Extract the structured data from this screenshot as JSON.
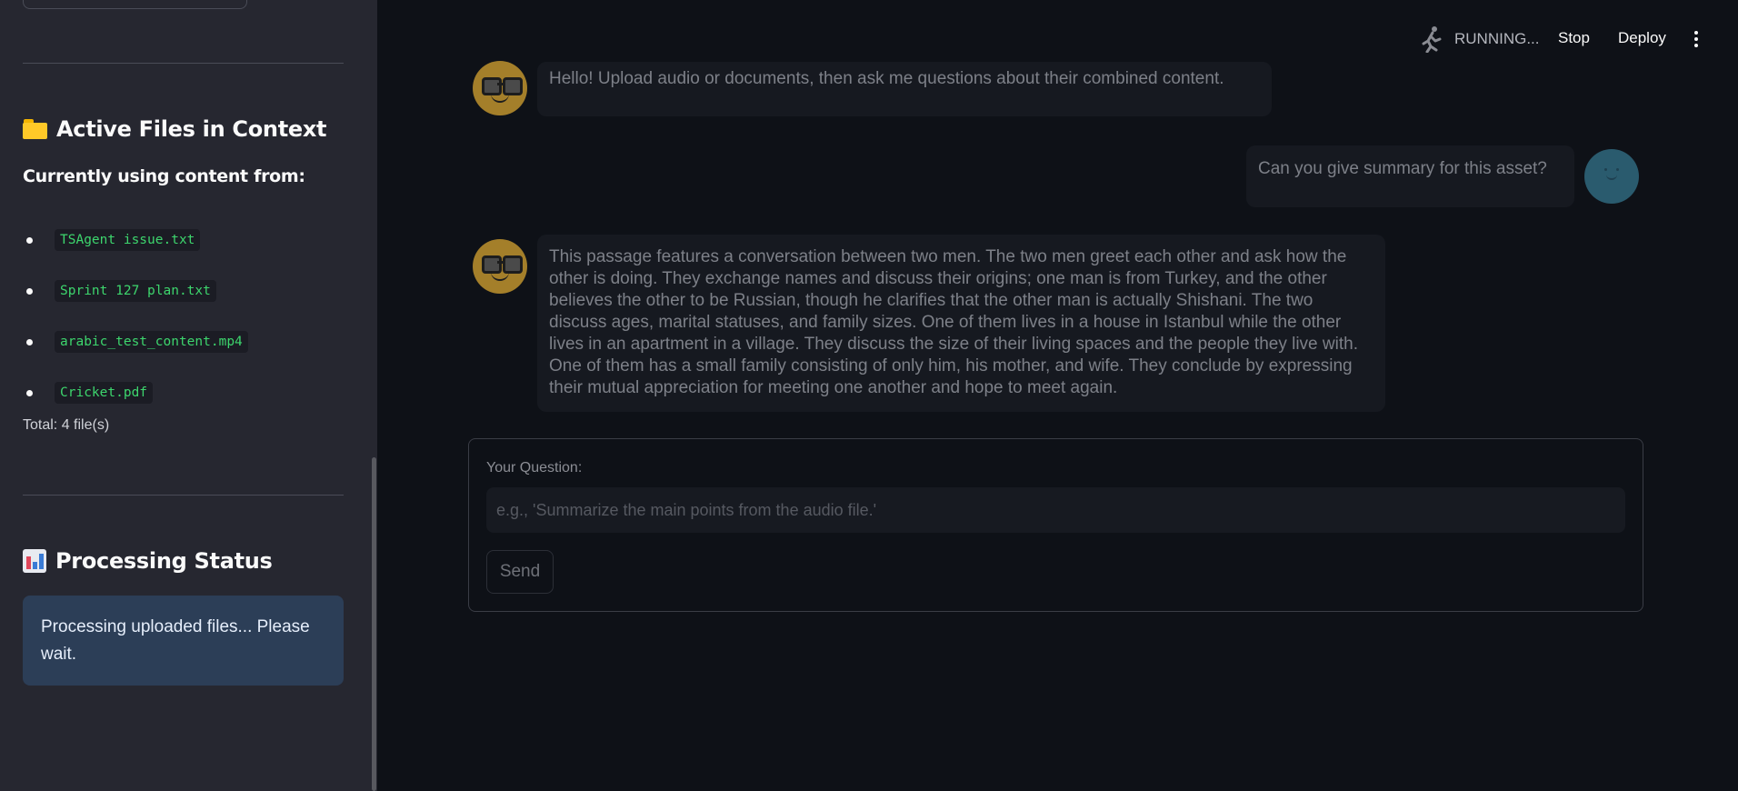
{
  "header": {
    "status": "RUNNING...",
    "stop_label": "Stop",
    "deploy_label": "Deploy"
  },
  "sidebar": {
    "active_files_heading": "Active Files in Context",
    "currently_using": "Currently using content from:",
    "files": [
      "TSAgent issue.txt",
      "Sprint 127 plan.txt",
      "arabic_test_content.mp4",
      "Cricket.pdf"
    ],
    "total": "Total: 4 file(s)",
    "processing_heading": "Processing Status",
    "processing_message": "Processing uploaded files... Please wait."
  },
  "chat": {
    "messages": [
      {
        "role": "assistant",
        "text": "Hello! Upload audio or documents, then ask me questions about their combined content."
      },
      {
        "role": "user",
        "text": "Can you give summary for this asset?"
      },
      {
        "role": "assistant",
        "text": "This passage features a conversation between two men. The two men greet each other and ask how the other is doing. They exchange names and discuss their origins; one man is from Turkey, and the other believes the other to be Russian, though he clarifies that the other man is actually Shishani. The two discuss ages, marital statuses, and family sizes. One of them lives in a house in Istanbul while the other lives in an apartment in a village. They discuss the size of their living spaces and the people they live with. One of them has a small family consisting of only him, his mother, and wife. They conclude by expressing their mutual appreciation for meeting one another and hope to meet again."
      }
    ]
  },
  "form": {
    "label": "Your Question:",
    "placeholder": "e.g., 'Summarize the main points from the audio file.'",
    "value": "",
    "send_label": "Send"
  },
  "colors": {
    "background": "#0e1117",
    "sidebar": "#262730",
    "file_code": "#3dd56d",
    "info_box": "#2c3e57"
  }
}
